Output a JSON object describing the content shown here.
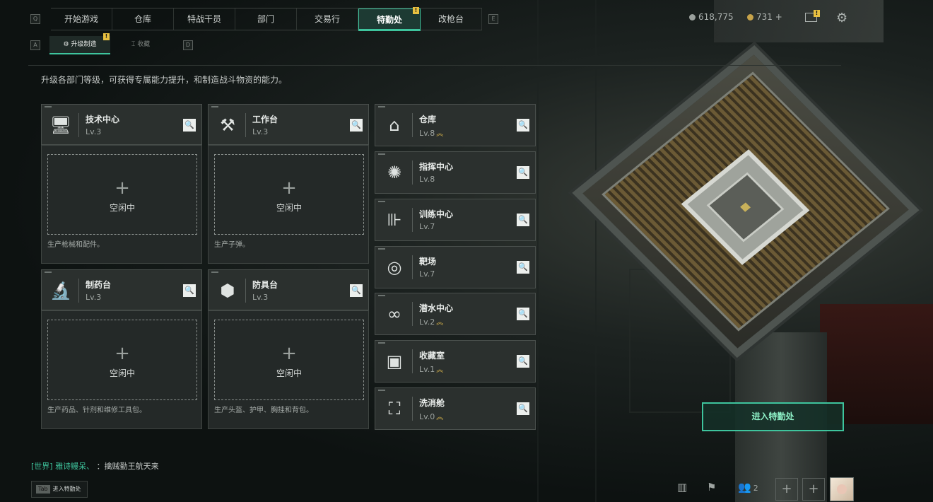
{
  "nav": {
    "key_left": "Q",
    "key_right": "E",
    "tabs": [
      "开始游戏",
      "仓库",
      "特战干员",
      "部门",
      "交易行",
      "特勤处",
      "改枪台"
    ],
    "active_tab": "特勤处",
    "badge": "!"
  },
  "currency": {
    "silver": "618,775",
    "gold": "731",
    "gold_add": "+"
  },
  "subnav": {
    "key_left": "A",
    "key_right": "D",
    "tabs": [
      "升级制造",
      "收藏"
    ],
    "active": "升级制造",
    "badge": "!"
  },
  "description": "升级各部门等级，可获得专属能力提升，和制造战斗物资的能力。",
  "workshops": [
    {
      "name": "技术中心",
      "level": "Lv.3",
      "icon": "computer-icon",
      "slot_label": "空闲中",
      "note": "生产枪械和配件。"
    },
    {
      "name": "工作台",
      "level": "Lv.3",
      "icon": "tools-icon",
      "slot_label": "空闲中",
      "note": "生产子弹。"
    },
    {
      "name": "制药台",
      "level": "Lv.3",
      "icon": "microscope-icon",
      "slot_label": "空闲中",
      "note": "生产药品、针剂和维修工具包。"
    },
    {
      "name": "防具台",
      "level": "Lv.3",
      "icon": "armor-blocks-icon",
      "slot_label": "空闲中",
      "note": "生产头盔、护甲、胸挂和背包。"
    }
  ],
  "departments": [
    {
      "name": "仓库",
      "level": "Lv.8",
      "upgradable": true,
      "icon": "warehouse-icon"
    },
    {
      "name": "指挥中心",
      "level": "Lv.8",
      "upgradable": false,
      "icon": "command-icon"
    },
    {
      "name": "训练中心",
      "level": "Lv.7",
      "upgradable": false,
      "icon": "dumbbell-icon"
    },
    {
      "name": "靶场",
      "level": "Lv.7",
      "upgradable": false,
      "icon": "target-icon"
    },
    {
      "name": "潜水中心",
      "level": "Lv.2",
      "upgradable": true,
      "icon": "diving-mask-icon"
    },
    {
      "name": "收藏室",
      "level": "Lv.1",
      "upgradable": true,
      "icon": "collection-icon"
    },
    {
      "name": "洗消舱",
      "level": "Lv.0",
      "upgradable": true,
      "icon": "decontamination-icon"
    }
  ],
  "enter_button": "进入特勤处",
  "chat": {
    "channel": "[世界]",
    "user": "雅诗鳗呆、",
    "message": "擒贼勤王航天来"
  },
  "tab_hint": {
    "key": "Tab",
    "label": "进入特勤处"
  },
  "bottom": {
    "party_count": "2"
  },
  "colors": {
    "accent": "#3ec49d",
    "upgrade": "#d6b24a",
    "badge": "#e8c040"
  }
}
